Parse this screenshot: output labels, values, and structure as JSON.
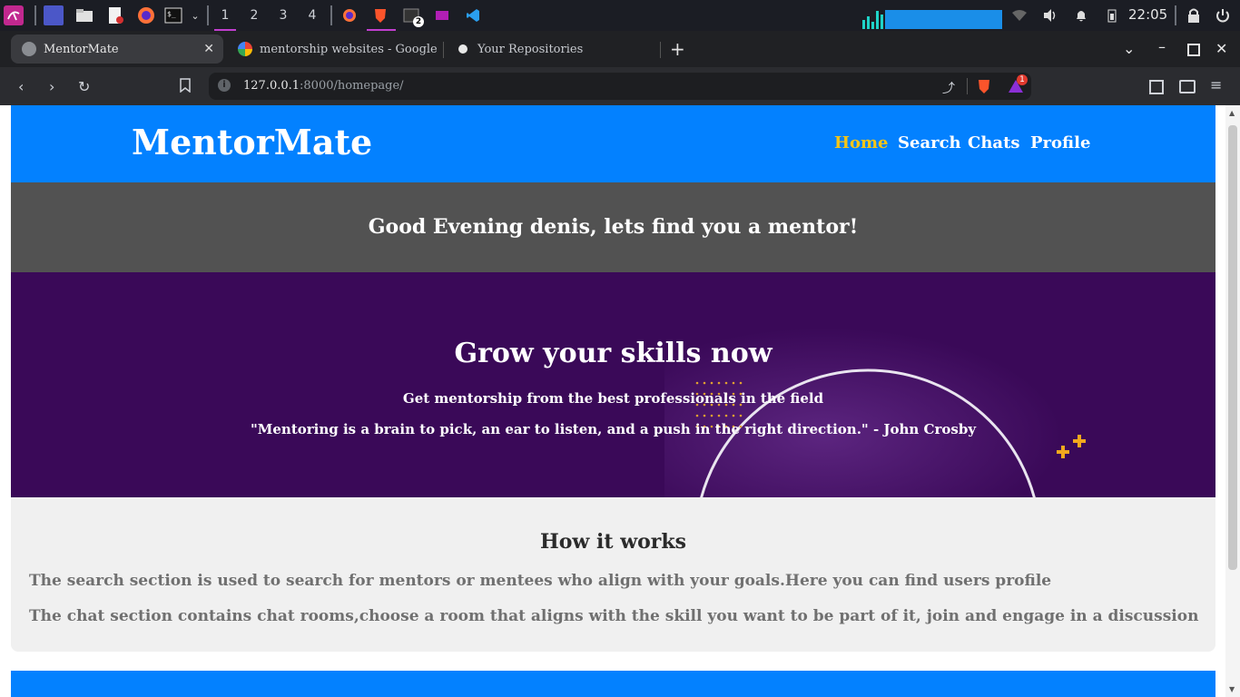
{
  "taskbar": {
    "workspaces": [
      "1",
      "2",
      "3",
      "4"
    ],
    "terminal_badge": "2",
    "clock": "22:05"
  },
  "browser": {
    "tabs": [
      {
        "title": "MentorMate",
        "active": true
      },
      {
        "title": "mentorship websites - Google Se",
        "active": false
      },
      {
        "title": "Your Repositories",
        "active": false
      }
    ],
    "url_host": "127.0.0.1",
    "url_path": ":8000/homepage/",
    "brave_badge": "1"
  },
  "site": {
    "brand": "MentorMate",
    "nav": [
      "Home",
      "Search",
      "Chats",
      "Profile"
    ],
    "nav_active_color": "#f5c518",
    "greeting": "Good Evening denis, lets find you a mentor!",
    "hero": {
      "title": "Grow your skills now",
      "subtitle": "Get mentorship from the best professionals in the field",
      "quote": "\"Mentoring is a brain to pick, an ear to listen, and a push in the right direction.\" - John Crosby"
    },
    "how": {
      "title": "How it works",
      "lines": [
        "The search section is used to search for mentors or mentees who align with your goals.Here you can find users profile",
        "The chat section contains chat rooms,choose a room that aligns with the skill you want to be part of it, join and engage in a discussion"
      ]
    },
    "colors": {
      "header": "#0381ff",
      "greeting_bg": "#525252",
      "hero_bg": "#3a0958"
    }
  }
}
